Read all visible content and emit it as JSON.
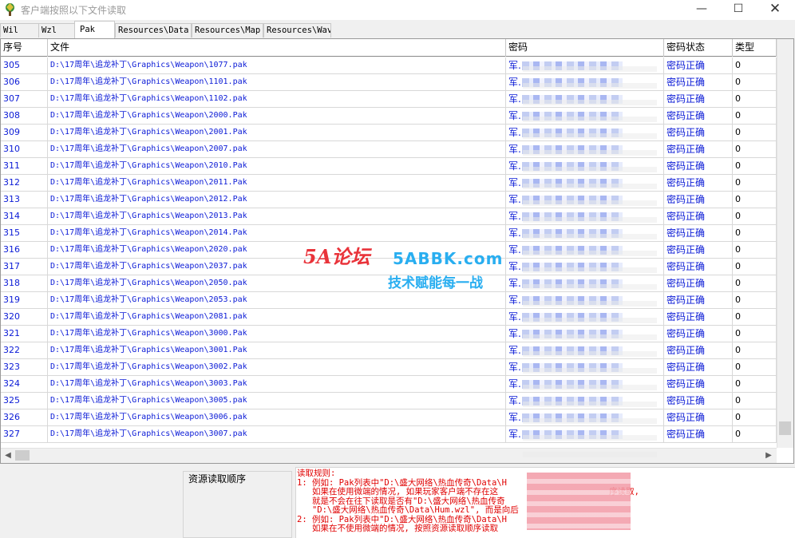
{
  "window": {
    "title": "客户端按照以下文件读取",
    "minimize_glyph": "—",
    "maximize_glyph": "☐",
    "close_glyph": "✕"
  },
  "tabs": [
    "Wil",
    "Wzl",
    "Pak",
    "Resources\\Data",
    "Resources\\Map",
    "Resources\\Wav"
  ],
  "active_tab": "Pak",
  "table": {
    "columns": [
      "序号",
      "文件",
      "密码",
      "密码状态",
      "类型"
    ],
    "rows": [
      {
        "id": "305",
        "file": "D:\\17周年\\追龙补丁\\Graphics\\Weapon\\1077.pak",
        "pwd": "军.",
        "status": "密码正确",
        "type": "0"
      },
      {
        "id": "306",
        "file": "D:\\17周年\\追龙补丁\\Graphics\\Weapon\\1101.pak",
        "pwd": "军.",
        "status": "密码正确",
        "type": "0"
      },
      {
        "id": "307",
        "file": "D:\\17周年\\追龙补丁\\Graphics\\Weapon\\1102.pak",
        "pwd": "军.",
        "status": "密码正确",
        "type": "0"
      },
      {
        "id": "308",
        "file": "D:\\17周年\\追龙补丁\\Graphics\\Weapon\\2000.Pak",
        "pwd": "军.",
        "status": "密码正确",
        "type": "0"
      },
      {
        "id": "309",
        "file": "D:\\17周年\\追龙补丁\\Graphics\\Weapon\\2001.Pak",
        "pwd": "军.",
        "status": "密码正确",
        "type": "0"
      },
      {
        "id": "310",
        "file": "D:\\17周年\\追龙补丁\\Graphics\\Weapon\\2007.pak",
        "pwd": "军.",
        "status": "密码正确",
        "type": "0"
      },
      {
        "id": "311",
        "file": "D:\\17周年\\追龙补丁\\Graphics\\Weapon\\2010.Pak",
        "pwd": "军.",
        "status": "密码正确",
        "type": "0"
      },
      {
        "id": "312",
        "file": "D:\\17周年\\追龙补丁\\Graphics\\Weapon\\2011.Pak",
        "pwd": "军.",
        "status": "密码正确",
        "type": "0"
      },
      {
        "id": "313",
        "file": "D:\\17周年\\追龙补丁\\Graphics\\Weapon\\2012.Pak",
        "pwd": "军.",
        "status": "密码正确",
        "type": "0"
      },
      {
        "id": "314",
        "file": "D:\\17周年\\追龙补丁\\Graphics\\Weapon\\2013.Pak",
        "pwd": "军.",
        "status": "密码正确",
        "type": "0"
      },
      {
        "id": "315",
        "file": "D:\\17周年\\追龙补丁\\Graphics\\Weapon\\2014.Pak",
        "pwd": "军.",
        "status": "密码正确",
        "type": "0"
      },
      {
        "id": "316",
        "file": "D:\\17周年\\追龙补丁\\Graphics\\Weapon\\2020.pak",
        "pwd": "军.",
        "status": "密码正确",
        "type": "0"
      },
      {
        "id": "317",
        "file": "D:\\17周年\\追龙补丁\\Graphics\\Weapon\\2037.pak",
        "pwd": "军.",
        "status": "密码正确",
        "type": "0"
      },
      {
        "id": "318",
        "file": "D:\\17周年\\追龙补丁\\Graphics\\Weapon\\2050.pak",
        "pwd": "军.",
        "status": "密码正确",
        "type": "0"
      },
      {
        "id": "319",
        "file": "D:\\17周年\\追龙补丁\\Graphics\\Weapon\\2053.pak",
        "pwd": "军.",
        "status": "密码正确",
        "type": "0"
      },
      {
        "id": "320",
        "file": "D:\\17周年\\追龙补丁\\Graphics\\Weapon\\2081.pak",
        "pwd": "军.",
        "status": "密码正确",
        "type": "0"
      },
      {
        "id": "321",
        "file": "D:\\17周年\\追龙补丁\\Graphics\\Weapon\\3000.Pak",
        "pwd": "军.",
        "status": "密码正确",
        "type": "0"
      },
      {
        "id": "322",
        "file": "D:\\17周年\\追龙补丁\\Graphics\\Weapon\\3001.Pak",
        "pwd": "军.",
        "status": "密码正确",
        "type": "0"
      },
      {
        "id": "323",
        "file": "D:\\17周年\\追龙补丁\\Graphics\\Weapon\\3002.Pak",
        "pwd": "军.",
        "status": "密码正确",
        "type": "0"
      },
      {
        "id": "324",
        "file": "D:\\17周年\\追龙补丁\\Graphics\\Weapon\\3003.Pak",
        "pwd": "军.",
        "status": "密码正确",
        "type": "0"
      },
      {
        "id": "325",
        "file": "D:\\17周年\\追龙补丁\\Graphics\\Weapon\\3005.pak",
        "pwd": "军.",
        "status": "密码正确",
        "type": "0"
      },
      {
        "id": "326",
        "file": "D:\\17周年\\追龙补丁\\Graphics\\Weapon\\3006.pak",
        "pwd": "军.",
        "status": "密码正确",
        "type": "0"
      },
      {
        "id": "327",
        "file": "D:\\17周年\\追龙补丁\\Graphics\\Weapon\\3007.pak",
        "pwd": "军.",
        "status": "密码正确",
        "type": "0"
      }
    ]
  },
  "watermark": {
    "logo": "5A论坛",
    "url": "5ABBK.com",
    "tagline": "技术赋能每一战"
  },
  "bottom": {
    "order_label": "资源读取顺序",
    "rules_lines": [
      "读取规则:",
      "1: 例如: Pak列表中\"D:\\盛大网络\\热血传奇\\Data\\H",
      "   如果在使用微端的情况, 如果玩家客户端不存在这                      序读取,",
      "   就是不会在往下读取是否有\"D:\\盛大网络\\热血传奇",
      "   \"D:\\盛大网络\\热血传奇\\Data\\Hum.wzl\", 而是向后",
      "2: 例如: Pak列表中\"D:\\盛大网络\\热血传奇\\Data\\H",
      "   如果在不使用微端的情况, 按照资源读取顺序读取"
    ]
  },
  "colors": {
    "row_text": "#0a1ad6",
    "rules_text": "#e00000",
    "watermark_red": "#e9333a",
    "watermark_blue": "#29aef0"
  }
}
